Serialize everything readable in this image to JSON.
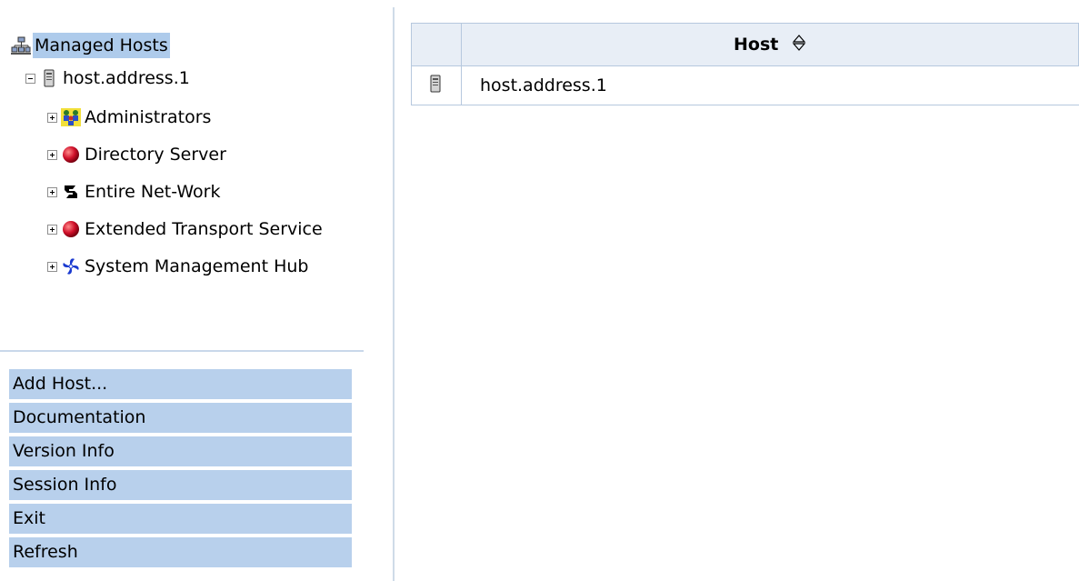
{
  "tree": {
    "root": {
      "label": "Managed Hosts",
      "icon": "network-hosts-icon"
    },
    "host": {
      "label": "host.address.1",
      "icon": "server-icon",
      "expanded": true
    },
    "children": [
      {
        "label": "Administrators",
        "icon": "administrators-icon"
      },
      {
        "label": "Directory Server",
        "icon": "red-ball-icon"
      },
      {
        "label": "Entire Net-Work",
        "icon": "entire-network-icon"
      },
      {
        "label": "Extended Transport Service",
        "icon": "red-ball-icon"
      },
      {
        "label": "System Management Hub",
        "icon": "smh-pinwheel-icon"
      }
    ]
  },
  "actions": [
    "Add Host...",
    "Documentation",
    "Version Info",
    "Session Info",
    "Exit",
    "Refresh"
  ],
  "table": {
    "column_header": "Host",
    "rows": [
      {
        "icon": "server-icon",
        "host": "host.address.1"
      }
    ]
  },
  "colors": {
    "selection": "#aecbeb",
    "action_background": "#b8d0ec",
    "table_header_background": "#e8eef6",
    "border": "#b6c8de"
  }
}
